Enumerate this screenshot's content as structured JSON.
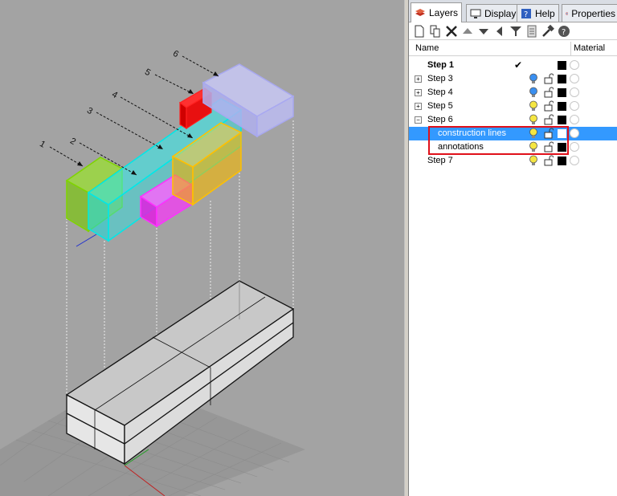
{
  "panel": {
    "tabs": [
      {
        "label": "Layers",
        "icon": "layers-icon",
        "active": true
      },
      {
        "label": "Display",
        "icon": "display-icon",
        "active": false
      },
      {
        "label": "Help",
        "icon": "help-icon",
        "active": false
      },
      {
        "label": "Properties",
        "icon": "properties-icon",
        "active": false
      }
    ],
    "toolbar": [
      "new-layer-icon",
      "new-sublayer-icon",
      "delete-icon",
      "move-up-icon",
      "move-down-icon",
      "move-left-icon",
      "filter-icon",
      "layer-states-icon",
      "tools-icon",
      "help-icon"
    ],
    "columns": {
      "name": "Name",
      "material": "Material"
    },
    "layers": [
      {
        "name": "Step 1",
        "bold": true,
        "current": true,
        "expander": "",
        "indent": 0,
        "bulb": "none",
        "selected": false,
        "color": "#000000"
      },
      {
        "name": "Step 3",
        "bold": false,
        "current": false,
        "expander": "+",
        "indent": 0,
        "bulb": "blue",
        "selected": false,
        "color": "#000000"
      },
      {
        "name": "Step 4",
        "bold": false,
        "current": false,
        "expander": "+",
        "indent": 0,
        "bulb": "blue",
        "selected": false,
        "color": "#000000"
      },
      {
        "name": "Step 5",
        "bold": false,
        "current": false,
        "expander": "+",
        "indent": 0,
        "bulb": "yellow",
        "selected": false,
        "color": "#000000"
      },
      {
        "name": "Step 6",
        "bold": false,
        "current": false,
        "expander": "−",
        "indent": 0,
        "bulb": "yellow",
        "selected": false,
        "color": "#000000"
      },
      {
        "name": "construction lines",
        "bold": false,
        "current": false,
        "expander": "",
        "indent": 1,
        "bulb": "yellow",
        "selected": true,
        "color": "#ffffff"
      },
      {
        "name": "annotations",
        "bold": false,
        "current": false,
        "expander": "",
        "indent": 1,
        "bulb": "yellow",
        "selected": false,
        "color": "#000000"
      },
      {
        "name": "Step 7",
        "bold": false,
        "current": false,
        "expander": "",
        "indent": 0,
        "bulb": "yellow",
        "selected": false,
        "color": "#000000"
      }
    ],
    "current_mark": "✔"
  },
  "viewport": {
    "annotations": [
      "1",
      "2",
      "3",
      "4",
      "5",
      "6"
    ],
    "colors": {
      "green": "#7fd400",
      "cyan": "#00e0e0",
      "magenta": "#e000e0",
      "orange": "#f0b000",
      "red": "#e00000",
      "lavender": "#b8b8f0",
      "highlight": "#e0101a"
    }
  }
}
